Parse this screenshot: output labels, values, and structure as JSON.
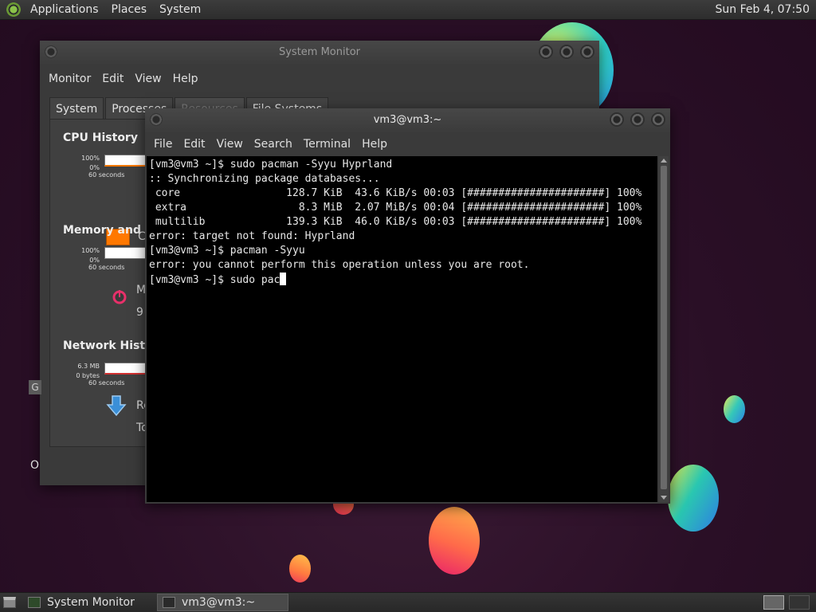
{
  "top_panel": {
    "menus": [
      "Applications",
      "Places",
      "System"
    ],
    "clock": "Sun Feb  4, 07:50"
  },
  "sysmon": {
    "title": "System Monitor",
    "menus": [
      "Monitor",
      "Edit",
      "View",
      "Help"
    ],
    "tabs": [
      "System",
      "Processes",
      "Resources",
      "File Systems"
    ],
    "active_tab": "Resources",
    "cpu": {
      "title": "CPU History",
      "ymax": "100%",
      "ymin": "0%",
      "span": "60 seconds",
      "legend_truncated": "C"
    },
    "memory": {
      "title": "Memory and Swap",
      "ymax": "100%",
      "ymin": "0%",
      "span": "60 seconds",
      "label_truncated": "M",
      "value_truncated": "9"
    },
    "network": {
      "title": "Network History",
      "ymax": "6.3 MB",
      "ymin": "0 bytes",
      "span": "60 seconds",
      "label_truncated": "Re",
      "total_truncated": "To"
    },
    "side_label": "G",
    "bottom_label": "O"
  },
  "terminal": {
    "title": "vm3@vm3:~",
    "menus": [
      "File",
      "Edit",
      "View",
      "Search",
      "Terminal",
      "Help"
    ],
    "lines": [
      "[vm3@vm3 ~]$ sudo pacman -Syyu Hyprland",
      ":: Synchronizing package databases...",
      " core                 128.7 KiB  43.6 KiB/s 00:03 [######################] 100%",
      " extra                  8.3 MiB  2.07 MiB/s 00:04 [######################] 100%",
      " multilib             139.3 KiB  46.0 KiB/s 00:03 [######################] 100%",
      "error: target not found: Hyprland",
      "[vm3@vm3 ~]$ pacman -Syyu",
      "error: you cannot perform this operation unless you are root."
    ],
    "prompt_line": "[vm3@vm3 ~]$ sudo pac"
  },
  "bottom_panel": {
    "tasks": [
      "System Monitor",
      "vm3@vm3:~"
    ],
    "active_task": "vm3@vm3:~"
  },
  "colors": {
    "desktop": "#2a0f26",
    "cpu_line": "#ff7800",
    "terminal_bg": "#000000",
    "terminal_fg": "#e8e8e8"
  }
}
